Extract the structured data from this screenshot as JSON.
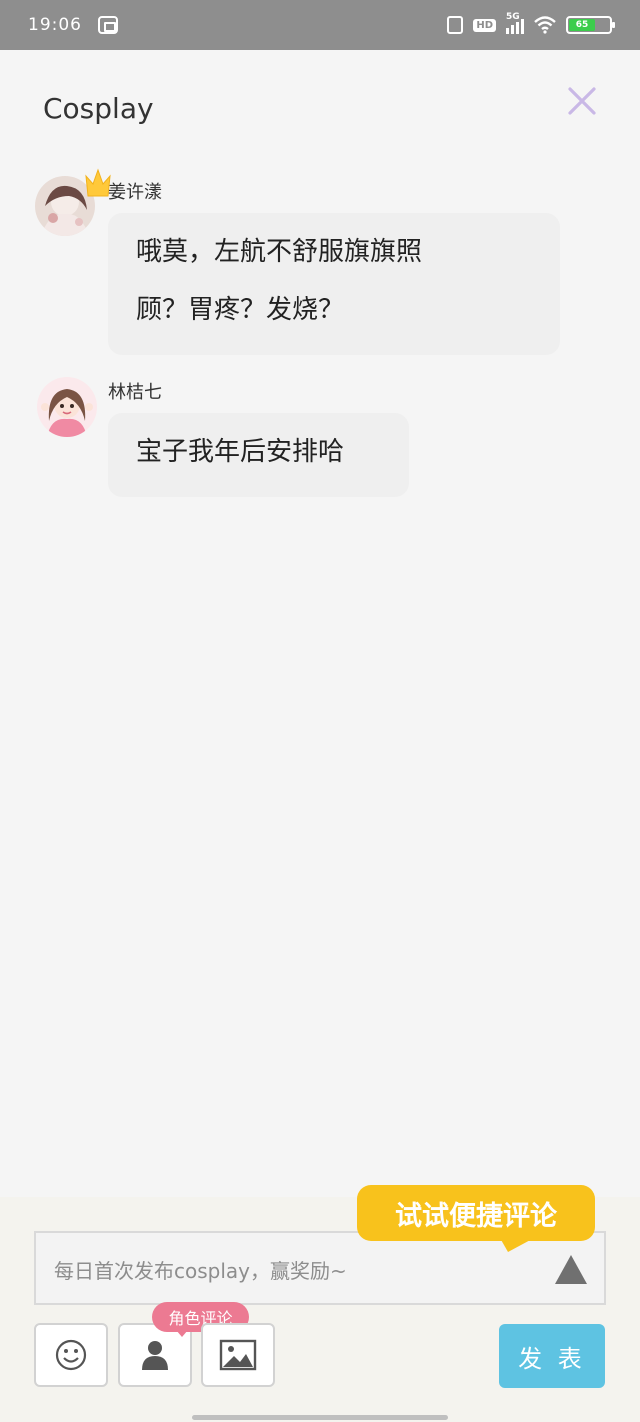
{
  "status_bar": {
    "time": "19:06",
    "network": "5G",
    "hd": "HD",
    "battery": "65"
  },
  "header": {
    "title": "Cosplay"
  },
  "messages": [
    {
      "name": "姜许漾",
      "lines": [
        "哦莫，左航不舒服旗旗照",
        "顾？胃疼？发烧？"
      ]
    },
    {
      "name": "林桔七",
      "lines": [
        "宝子我年后安排哈"
      ]
    }
  ],
  "composer": {
    "placeholder": "每日首次发布cosplay，赢奖励~",
    "tooltip": "试试便捷评论",
    "role_badge": "角色评论",
    "send_label": "发 表"
  },
  "colors": {
    "accent_yellow": "#f8c21c",
    "send_blue": "#5ec3e2",
    "badge_pink": "#ec7a92",
    "close_lavender": "#c9b8e6"
  }
}
